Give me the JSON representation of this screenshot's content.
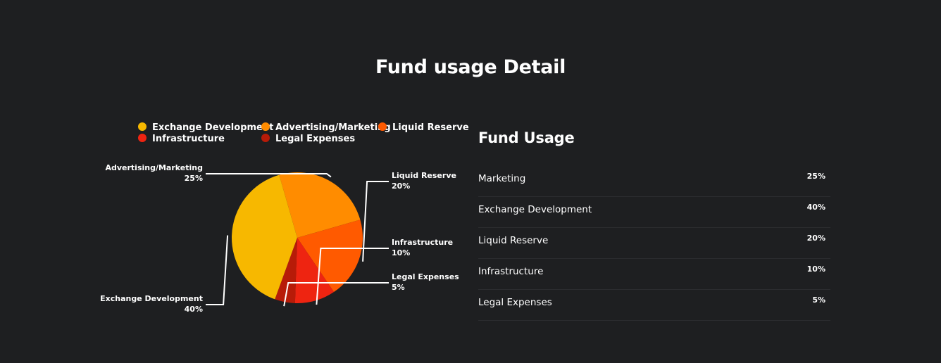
{
  "page_title": "Fund usage Detail",
  "chart_data": {
    "type": "pie",
    "title": "",
    "categories": [
      "Exchange Development",
      "Advertising/Marketing",
      "Liquid Reserve",
      "Infrastructure",
      "Legal Expenses"
    ],
    "values": [
      40,
      25,
      20,
      10,
      5
    ],
    "value_labels": [
      "40%",
      "25%",
      "20%",
      "10%",
      "5%"
    ],
    "colors": [
      "#f7b800",
      "#ff8c00",
      "#ff5a00",
      "#ee2411",
      "#b71b08"
    ],
    "legend_position": "top",
    "slice_order": [
      "Advertising/Marketing",
      "Liquid Reserve",
      "Infrastructure",
      "Legal Expenses",
      "Exchange Development"
    ]
  },
  "usage": {
    "title": "Fund Usage",
    "rows": [
      {
        "label": "Marketing",
        "value": "25%"
      },
      {
        "label": "Exchange Development",
        "value": "40%"
      },
      {
        "label": "Liquid Reserve",
        "value": "20%"
      },
      {
        "label": "Infrastructure",
        "value": "10%"
      },
      {
        "label": "Legal Expenses",
        "value": "5%"
      }
    ]
  }
}
